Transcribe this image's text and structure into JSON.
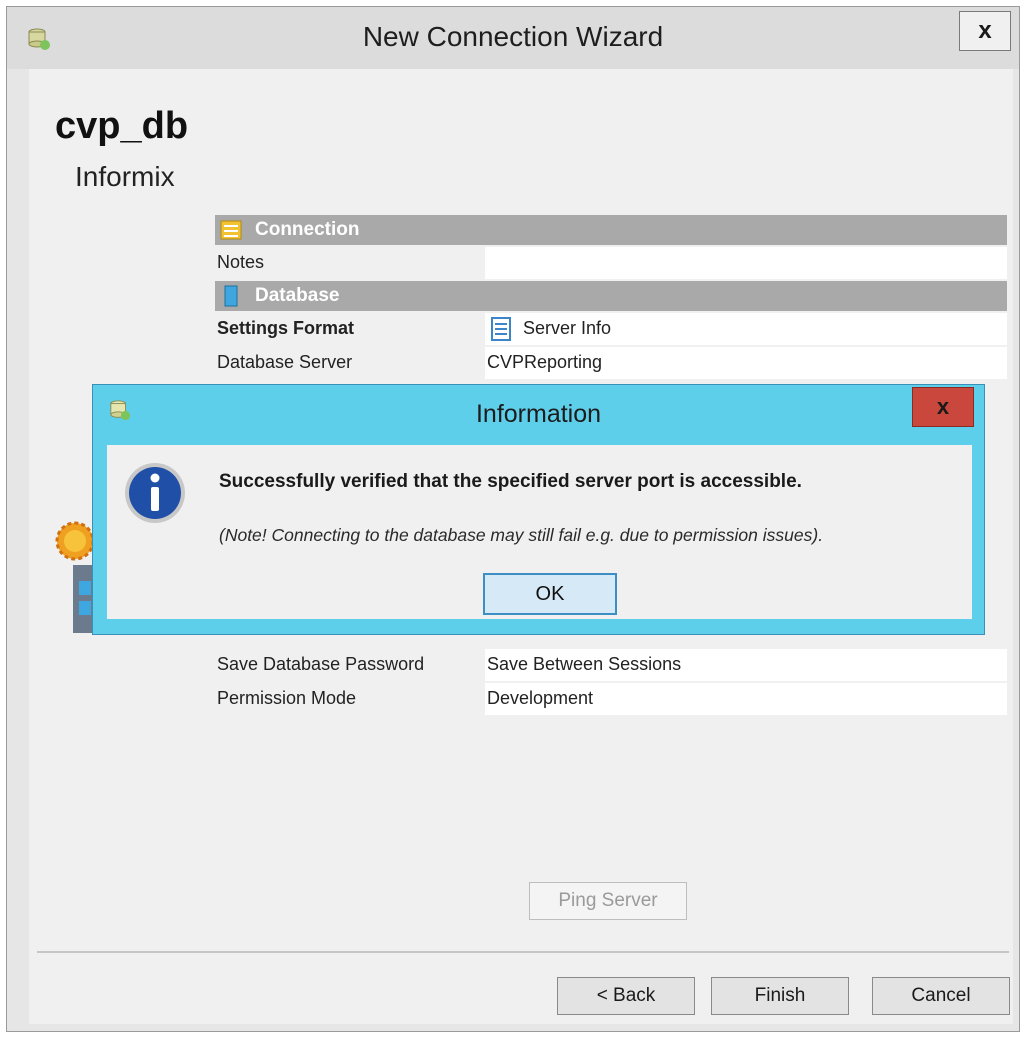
{
  "wizard": {
    "title": "New Connection Wizard",
    "close_label": "x",
    "connection_name": "cvp_db",
    "connection_type": "Informix",
    "sections": {
      "connection": "Connection",
      "database": "Database"
    },
    "rows": {
      "notes": {
        "key": "Notes",
        "value": ""
      },
      "settings_format": {
        "key": "Settings Format",
        "value": "Server Info"
      },
      "database_server": {
        "key": "Database Server",
        "value": "CVPReporting"
      },
      "save_password": {
        "key": "Save Database Password",
        "value": "Save Between Sessions"
      },
      "permission_mode": {
        "key": "Permission Mode",
        "value": "Development"
      }
    },
    "buttons": {
      "ping": "Ping Server",
      "back": "< Back",
      "finish": "Finish",
      "cancel": "Cancel"
    }
  },
  "dialog": {
    "title": "Information",
    "close_label": "x",
    "message": "Successfully verified that the specified server port is accessible.",
    "note": "(Note! Connecting to the database may still fail e.g. due to permission issues).",
    "ok_label": "OK"
  },
  "icons": {
    "app": "database-app-icon",
    "connection_section": "connection-icon",
    "database_section": "database-icon",
    "settings_format": "server-info-icon",
    "info": "info-icon"
  },
  "colors": {
    "dialog_frame": "#5ecfea",
    "dialog_close": "#c9473c",
    "section_header": "#a9a9a9",
    "ok_border": "#3d8ec4"
  }
}
